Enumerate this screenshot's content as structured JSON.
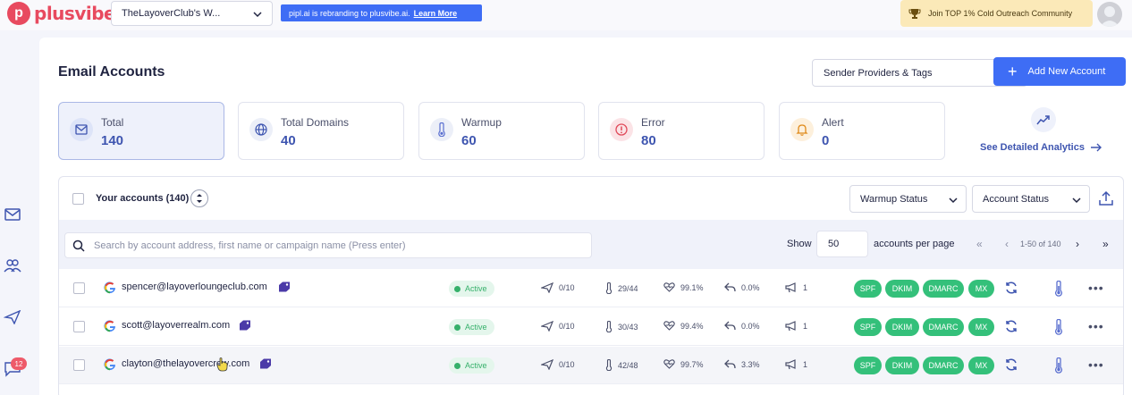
{
  "brand": {
    "name": "plusvibe",
    "accent": "#e84a5f"
  },
  "workspace": {
    "selected": "TheLayoverClub's W..."
  },
  "banner": {
    "text": "pipl.ai is rebranding to plusvibe.ai.",
    "link": "Learn More"
  },
  "community": {
    "label": "Join TOP 1% Cold Outreach Community"
  },
  "sidebar": {
    "items": [
      "mail-icon",
      "users-icon",
      "send-icon",
      "chat-icon"
    ],
    "chat_badge": "12"
  },
  "page": {
    "title": "Email Accounts"
  },
  "providers_filter": {
    "selected": "Sender Providers & Tags"
  },
  "add_account": {
    "label": "Add New Account"
  },
  "stats": [
    {
      "label": "Total",
      "value": "140",
      "icon": "mail-icon"
    },
    {
      "label": "Total Domains",
      "value": "40",
      "icon": "globe-icon"
    },
    {
      "label": "Warmup",
      "value": "60",
      "icon": "thermometer-icon"
    },
    {
      "label": "Error",
      "value": "80",
      "icon": "alert-circle-icon"
    },
    {
      "label": "Alert",
      "value": "0",
      "icon": "bell-icon"
    }
  ],
  "analytics": {
    "link": "See Detailed Analytics"
  },
  "accounts": {
    "header": "Your accounts (140)",
    "warmup_filter": "Warmup Status",
    "status_filter": "Account Status",
    "search_placeholder": "Search by account address, first name or campaign name (Press enter)",
    "show_label": "Show",
    "per_page_value": "50",
    "per_page_label": "accounts per page",
    "page_range": "1-50 of 140",
    "rows": [
      {
        "email": "spencer@layoverloungeclub.com",
        "status": "Active",
        "sent": "0/10",
        "warmup": "29/44",
        "health": "99.1%",
        "reply": "0.0%",
        "campaigns": "1",
        "spf": "SPF",
        "dkim": "DKIM",
        "dmarc": "DMARC",
        "mx": "MX"
      },
      {
        "email": "scott@layoverrealm.com",
        "status": "Active",
        "sent": "0/10",
        "warmup": "30/43",
        "health": "99.4%",
        "reply": "0.0%",
        "campaigns": "1",
        "spf": "SPF",
        "dkim": "DKIM",
        "dmarc": "DMARC",
        "mx": "MX"
      },
      {
        "email": "clayton@thelayovercrew.com",
        "status": "Active",
        "sent": "0/10",
        "warmup": "42/48",
        "health": "99.7%",
        "reply": "3.3%",
        "campaigns": "1",
        "spf": "SPF",
        "dkim": "DKIM",
        "dmarc": "DMARC",
        "mx": "MX"
      }
    ]
  },
  "colors": {
    "primary": "#3e6df5",
    "active_green": "#35b06a",
    "auth_green": "#34c07a",
    "stat_value": "#3e55b0"
  }
}
